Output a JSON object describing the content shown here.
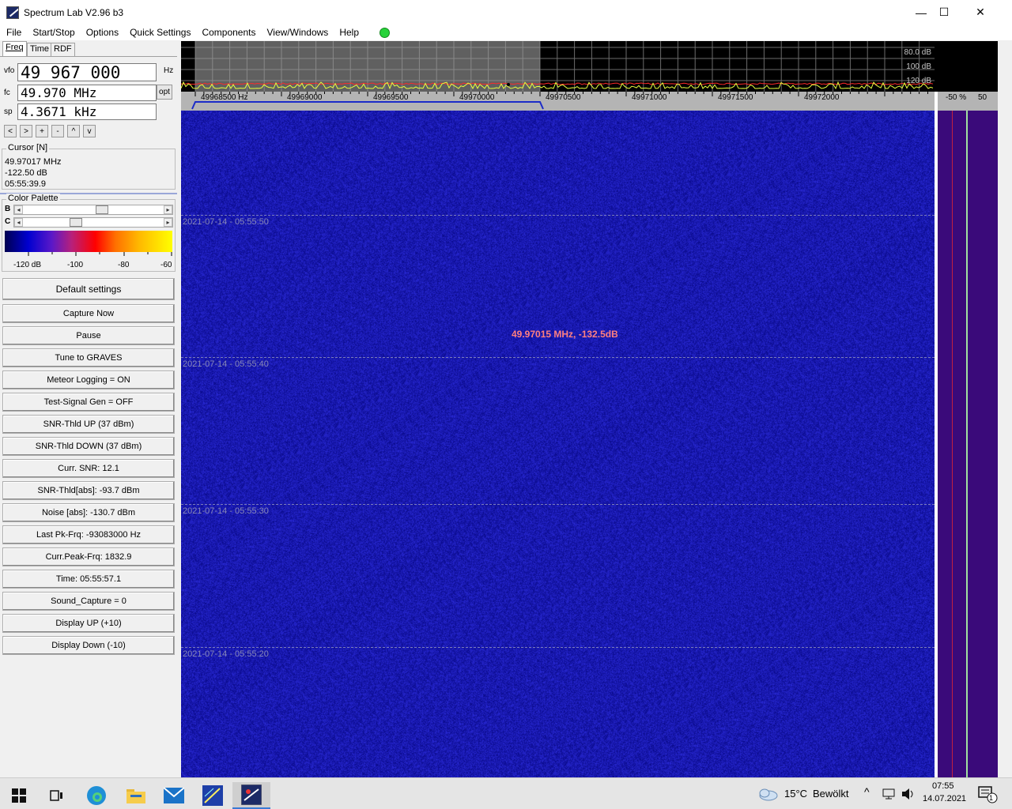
{
  "window": {
    "title": "Spectrum Lab V2.96 b3",
    "controls": {
      "minimize": "—",
      "maximize": "☐",
      "close": "✕"
    }
  },
  "menu": [
    "File",
    "Start/Stop",
    "Options",
    "Quick Settings",
    "Components",
    "View/Windows",
    "Help"
  ],
  "tabs": [
    "Freq",
    "Time",
    "RDF"
  ],
  "freq": {
    "vfo_label": "vfo",
    "vfo_value": "49 967 000",
    "vfo_unit": "Hz",
    "fc_label": "fc",
    "fc_value": "49.970 MHz",
    "opt_label": "opt",
    "sp_label": "sp",
    "sp_value": "4.3671 kHz",
    "buttons": [
      "<",
      ">",
      "+",
      "-",
      "^",
      "v"
    ]
  },
  "cursor": {
    "title": "Cursor [N]",
    "freq": "49.97017 MHz",
    "level": "-122.50 dB",
    "time": "05:55:39.9"
  },
  "palette": {
    "title": "Color Palette",
    "b_label": "B",
    "c_label": "C",
    "b_level": 0.56,
    "c_level": 0.36,
    "scale_labels": [
      "-120 dB",
      "-100",
      "-80",
      "-60"
    ]
  },
  "buttons": [
    "Default settings",
    "Capture Now",
    "Pause",
    "Tune to GRAVES",
    "Meteor Logging = ON",
    "Test-Signal Gen = OFF",
    "SNR-Thld UP (37 dBm)",
    "SNR-Thld DOWN (37 dBm)",
    "Curr. SNR: 12.1",
    "SNR-Thld[abs]: -93.7 dBm",
    "Noise [abs]: -130.7 dBm",
    "Last Pk-Frq: -93083000 Hz",
    "Curr.Peak-Frq: 1832.9",
    "Time:  05:55:57.1",
    "Sound_Capture = 0",
    "Display UP (+10)",
    "Display Down (-10)"
  ],
  "spectrum": {
    "db_labels": [
      "80.0 dB",
      "100 dB",
      "120 dB"
    ],
    "freq_labels": [
      "49968500 Hz",
      "49969000",
      "49969500",
      "49970000",
      "49970500",
      "49971000",
      "49971500",
      "49972000"
    ],
    "right_scale": [
      "-50 %",
      "50"
    ]
  },
  "waterfall": {
    "timestamps": [
      "2021-07-14 - 05:55:50",
      "2021-07-14 - 05:55:40",
      "2021-07-14 - 05:55:30",
      "2021-07-14 - 05:55:20"
    ],
    "marker_text": "49.97015 MHz, -132.5dB",
    "bg_color": "#1414a0",
    "marker_color": "#ff8080"
  },
  "taskbar": {
    "apps": [
      "start-icon",
      "task-view-icon",
      "edge-icon",
      "explorer-icon",
      "mail-icon",
      "spectrum-app-icon",
      "spectrum-lab-icon"
    ],
    "weather_temp": "15°C",
    "weather_text": "Bewölkt",
    "time": "07:55",
    "date": "14.07.2021",
    "notification_count": "1"
  }
}
